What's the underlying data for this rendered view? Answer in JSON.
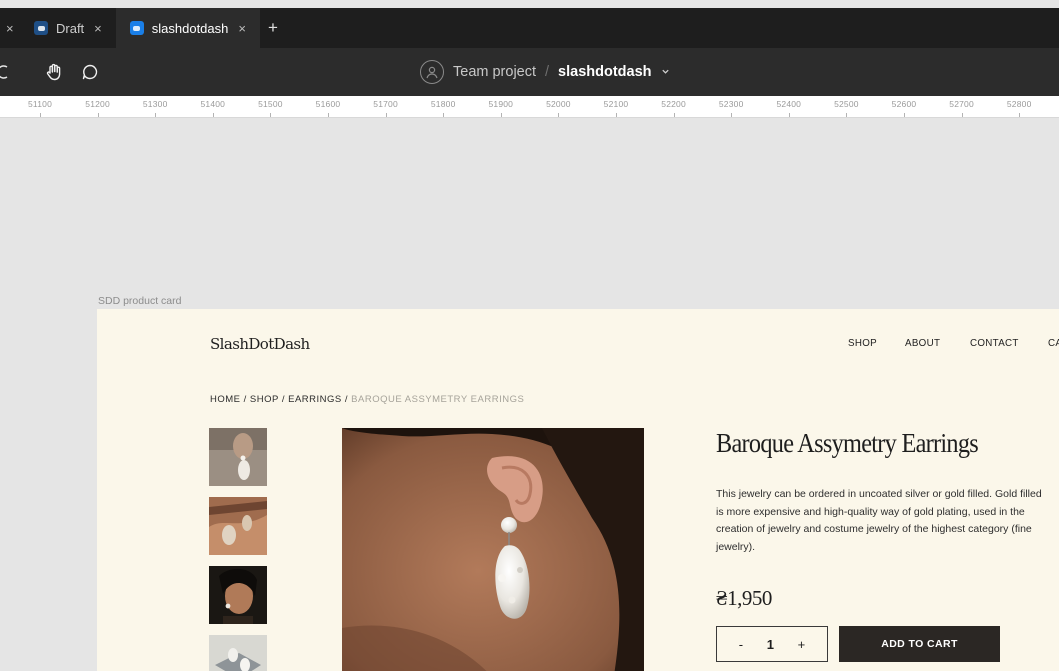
{
  "tabs": [
    {
      "label": "Draft",
      "active": false
    },
    {
      "label": "slashdotdash",
      "active": true
    }
  ],
  "tab_close_glyph": "×",
  "tab_add_glyph": "+",
  "toolbar": {
    "team": "Team project",
    "separator": "/",
    "file": "slashdotdash"
  },
  "ruler": {
    "labels": [
      "51100",
      "51200",
      "51300",
      "51400",
      "51500",
      "51600",
      "51700",
      "51800",
      "51900",
      "52000",
      "52100",
      "52200",
      "52300",
      "52400",
      "52500",
      "52600",
      "52700",
      "52800"
    ]
  },
  "frame": {
    "label": "SDD product card",
    "logo": "SlashDotDash",
    "nav": [
      "SHOP",
      "ABOUT",
      "CONTACT",
      "CA"
    ],
    "breadcrumb": {
      "links": [
        "HOME",
        "SHOP",
        "EARRINGS"
      ],
      "sep": "/",
      "current": "BAROQUE ASSYMETRY EARRINGS"
    },
    "product": {
      "title": "Baroque Assymetry Earrings",
      "description": "This jewelry can be ordered in uncoated silver or gold filled. Gold filled is more expensive and high-quality way of gold plating, used in the creation of jewelry and costume jewelry of the highest category (fine jewelry).",
      "price": "₴1,950",
      "quantity": {
        "minus": "-",
        "value": "1",
        "plus": "+"
      },
      "add_to_cart": "ADD TO CART"
    }
  },
  "colors": {
    "tabbar": "#1e1e1e",
    "toolbar": "#2c2c2c",
    "canvas": "#e5e5e5",
    "frame_bg": "#fbf7ea",
    "accent_button": "#2b2724",
    "figma_blue": "#1a7fe8"
  }
}
